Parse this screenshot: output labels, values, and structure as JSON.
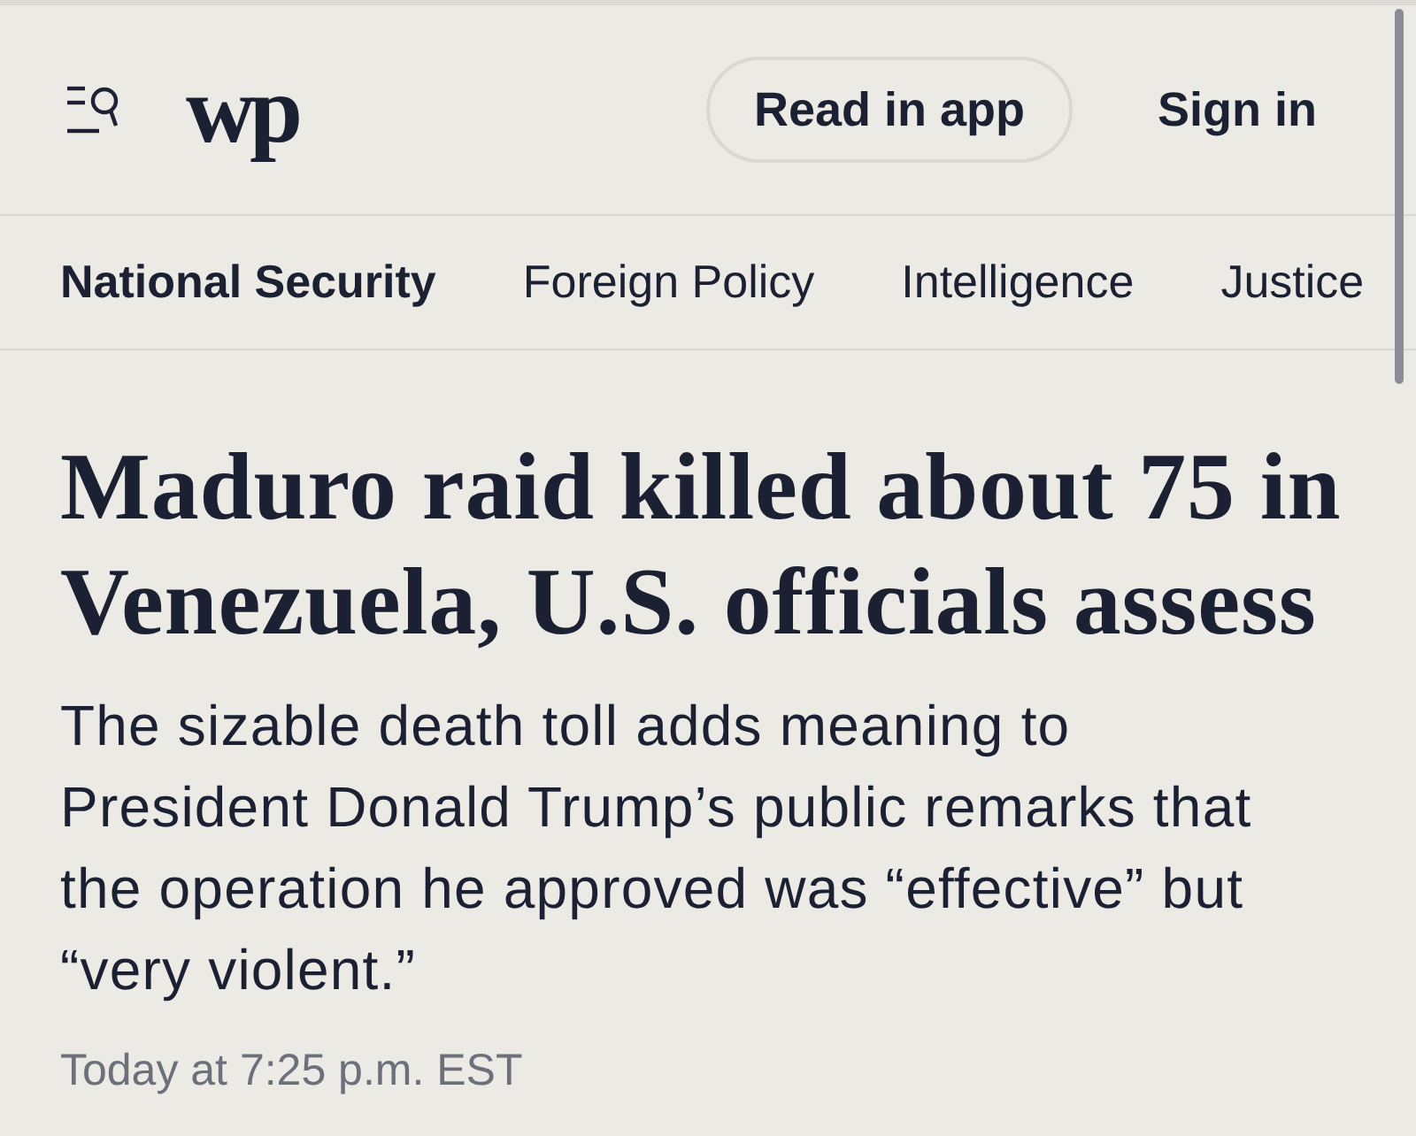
{
  "header": {
    "logo": "wp",
    "buttons": [
      {
        "label": "Read in app",
        "kind": "pill"
      },
      {
        "label": "Sign in",
        "kind": "link"
      }
    ]
  },
  "nav": {
    "tabs": [
      {
        "label": "National Security",
        "selected": true
      },
      {
        "label": "Foreign Policy",
        "selected": false
      },
      {
        "label": "Intelligence",
        "selected": false
      },
      {
        "label": "Justice",
        "selected": false
      }
    ]
  },
  "article": {
    "headline": "Maduro raid killed about 75 in Venezuela, U.S. officials assess",
    "dek": "The sizable death toll adds meaning to President Donald Trump’s public remarks that the operation he approved was “effective” but “very violent.”",
    "timestamp": "Today at 7:25 p.m. EST"
  }
}
